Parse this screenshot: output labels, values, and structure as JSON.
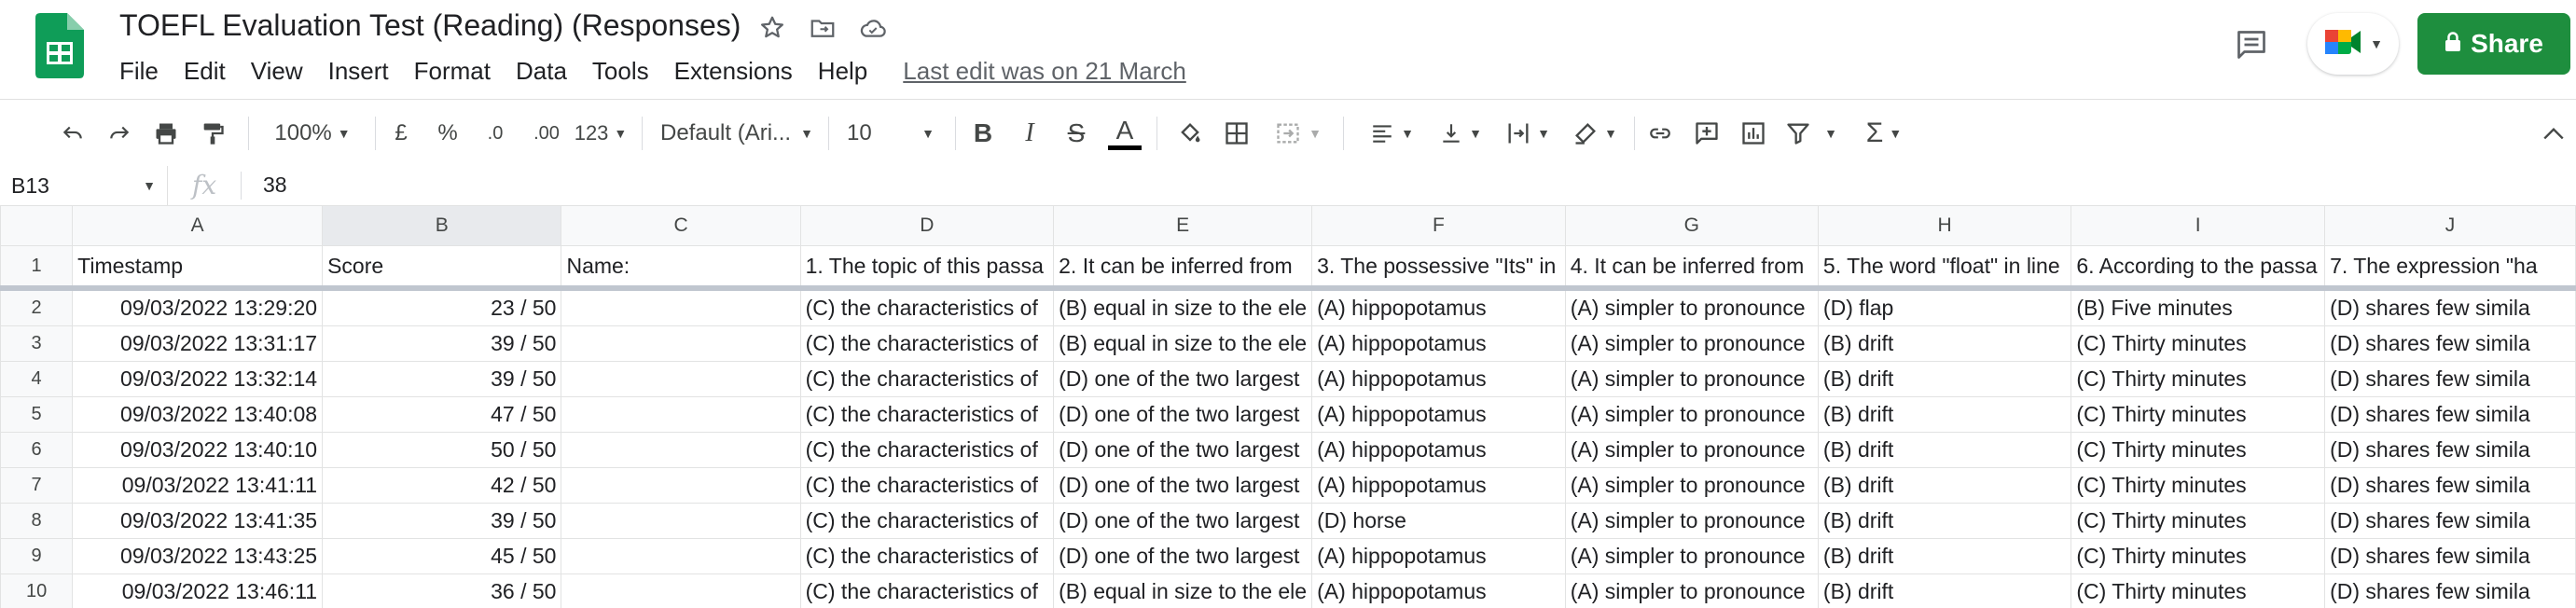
{
  "doc": {
    "title": "TOEFL Evaluation Test (Reading) (Responses)",
    "last_edit": "Last edit was on 21 March",
    "share_label": "Share"
  },
  "menu": [
    "File",
    "Edit",
    "View",
    "Insert",
    "Format",
    "Data",
    "Tools",
    "Extensions",
    "Help"
  ],
  "toolbar": {
    "zoom": "100%",
    "currency": "£",
    "percent": "%",
    "decrease_decimals": ".0",
    "increase_decimals": ".00",
    "more_formats": "123",
    "font": "Default (Ari...",
    "font_size": "10"
  },
  "formula_bar": {
    "cell_ref": "B13",
    "fx": "fx",
    "value": "38"
  },
  "colors": {
    "share_green": "#1e8e3e",
    "selection_blue": "#1a73e8",
    "sheets_green": "#0f9d58"
  },
  "grid": {
    "columns": [
      "A",
      "B",
      "C",
      "D",
      "E",
      "F",
      "G",
      "H",
      "I",
      "J"
    ],
    "header_row": {
      "num": "1",
      "cells": [
        "Timestamp",
        "Score",
        "Name:",
        "1. The topic of this passa",
        "2. It can be inferred from",
        "3. The possessive \"Its\" in",
        "4. It can be inferred from",
        "5. The word \"float\" in line",
        "6. According to the passa",
        "7. The expression \"ha"
      ]
    },
    "rows": [
      {
        "num": "2",
        "cells": [
          "09/03/2022 13:29:20",
          "23 / 50",
          "",
          "(C) the characteristics of",
          "(B) equal in size to the ele",
          "(A) hippopotamus",
          "(A) simpler to pronounce",
          "(D) flap",
          "(B) Five minutes",
          "(D) shares few simila"
        ]
      },
      {
        "num": "3",
        "cells": [
          "09/03/2022 13:31:17",
          "39 / 50",
          "",
          "(C) the characteristics of",
          "(B) equal in size to the ele",
          "(A) hippopotamus",
          "(A) simpler to pronounce",
          "(B) drift",
          "(C) Thirty minutes",
          "(D) shares few simila"
        ]
      },
      {
        "num": "4",
        "cells": [
          "09/03/2022 13:32:14",
          "39 / 50",
          "",
          "(C) the characteristics of",
          "(D) one of the two largest",
          "(A) hippopotamus",
          "(A) simpler to pronounce",
          "(B) drift",
          "(C) Thirty minutes",
          "(D) shares few simila"
        ]
      },
      {
        "num": "5",
        "cells": [
          "09/03/2022 13:40:08",
          "47 / 50",
          "",
          "(C) the characteristics of",
          "(D) one of the two largest",
          "(A) hippopotamus",
          "(A) simpler to pronounce",
          "(B) drift",
          "(C) Thirty minutes",
          "(D) shares few simila"
        ]
      },
      {
        "num": "6",
        "cells": [
          "09/03/2022 13:40:10",
          "50 / 50",
          "",
          "(C) the characteristics of",
          "(D) one of the two largest",
          "(A) hippopotamus",
          "(A) simpler to pronounce",
          "(B) drift",
          "(C) Thirty minutes",
          "(D) shares few simila"
        ]
      },
      {
        "num": "7",
        "cells": [
          "09/03/2022 13:41:11",
          "42 / 50",
          "",
          "(C) the characteristics of",
          "(D) one of the two largest",
          "(A) hippopotamus",
          "(A) simpler to pronounce",
          "(B) drift",
          "(C) Thirty minutes",
          "(D) shares few simila"
        ]
      },
      {
        "num": "8",
        "cells": [
          "09/03/2022 13:41:35",
          "39 / 50",
          "",
          "(C) the characteristics of",
          "(D) one of the two largest",
          "(D) horse",
          "(A) simpler to pronounce",
          "(B) drift",
          "(C) Thirty minutes",
          "(D) shares few simila"
        ]
      },
      {
        "num": "9",
        "cells": [
          "09/03/2022 13:43:25",
          "45 / 50",
          "",
          "(C) the characteristics of",
          "(D) one of the two largest",
          "(A) hippopotamus",
          "(A) simpler to pronounce",
          "(B) drift",
          "(C) Thirty minutes",
          "(D) shares few simila"
        ]
      },
      {
        "num": "10",
        "cells": [
          "09/03/2022 13:46:11",
          "36 / 50",
          "",
          "(C) the characteristics of",
          "(B) equal in size to the ele",
          "(A) hippopotamus",
          "(A) simpler to pronounce",
          "(B) drift",
          "(C) Thirty minutes",
          "(D) shares few simila"
        ]
      }
    ]
  }
}
